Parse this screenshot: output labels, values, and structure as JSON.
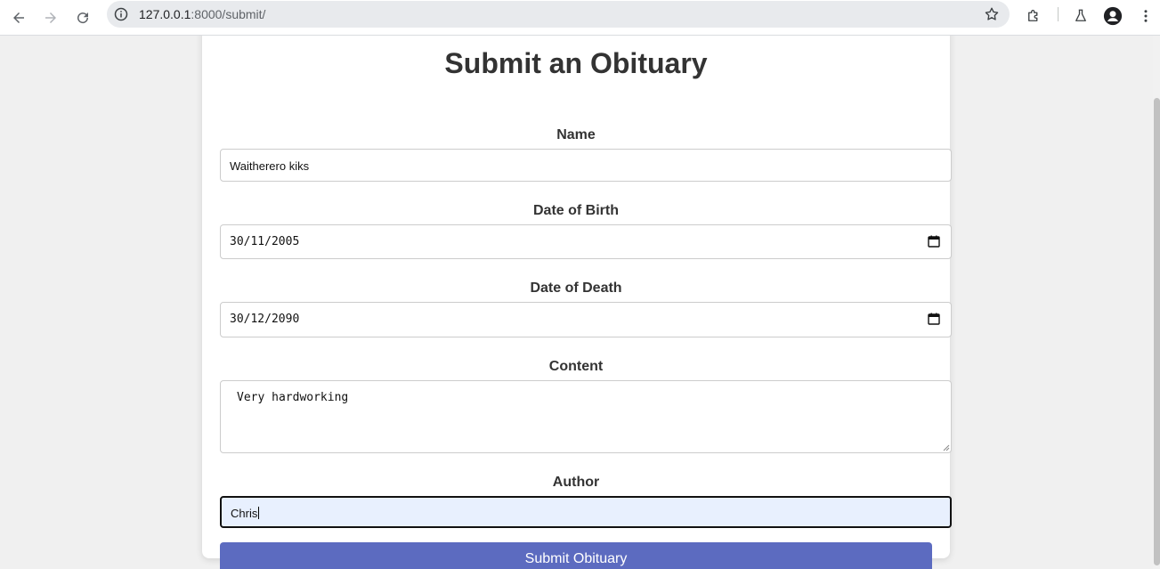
{
  "browser": {
    "url_host": "127.0.0.1",
    "url_path": ":8000/submit/"
  },
  "form": {
    "title": "Submit an Obituary",
    "name_label": "Name",
    "name_value": "Waitherero kiks",
    "dob_label": "Date of Birth",
    "dob_value": "30/11/2005",
    "dod_label": "Date of Death",
    "dod_value": "30/12/2090",
    "content_label": "Content",
    "content_value": "Very hardworking",
    "author_label": "Author",
    "author_value": "Chris",
    "submit_label": "Submit Obituary"
  },
  "colors": {
    "button": "#5c6bc0",
    "focused_field_bg": "#e8f0fe"
  }
}
